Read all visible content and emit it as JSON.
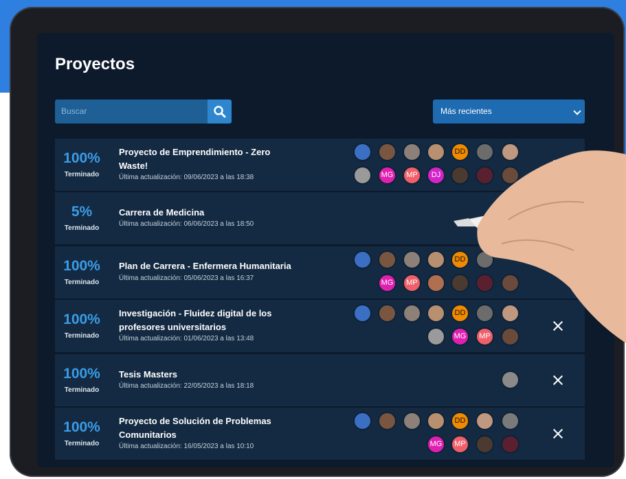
{
  "page": {
    "title": "Proyectos"
  },
  "search": {
    "placeholder": "Buscar"
  },
  "sort": {
    "selected": "Más recientes"
  },
  "done_label": "Terminado",
  "projects": [
    {
      "percent": "100%",
      "title_line1": "Proyecto de Emprendimiento - Zero",
      "title_line2": "Waste!",
      "updated": "Última actualización: 09/06/2023 a las 18:38"
    },
    {
      "percent": "5%",
      "title_line1": "Carrera de Medicina",
      "title_line2": "",
      "updated": "Última actualización: 06/06/2023 a las 18:50"
    },
    {
      "percent": "100%",
      "title_line1": "Plan de Carrera - Enfermera Humanitaria",
      "title_line2": "",
      "updated": "Última actualización: 05/06/2023 a las 16:37"
    },
    {
      "percent": "100%",
      "title_line1": "Investigación - Fluidez digital de los",
      "title_line2": "profesores universitarios",
      "updated": "Última actualización: 01/06/2023 a las 13:48"
    },
    {
      "percent": "100%",
      "title_line1": "Tesis Masters",
      "title_line2": "",
      "updated": "Última actualización: 22/05/2023 a las 18:18"
    },
    {
      "percent": "100%",
      "title_line1": "Proyecto de Solución de Problemas",
      "title_line2": "Comunitarios",
      "updated": "Última actualización: 16/05/2023 a las 10:10"
    }
  ],
  "initials": {
    "dd": "DD",
    "mg": "MG",
    "mp": "MP",
    "dj": "DJ"
  },
  "colors": {
    "accent": "#3a9ce8",
    "orange": "#f08a00",
    "magenta": "#e020b0",
    "salmon": "#f0606a",
    "row": "#132a42"
  }
}
